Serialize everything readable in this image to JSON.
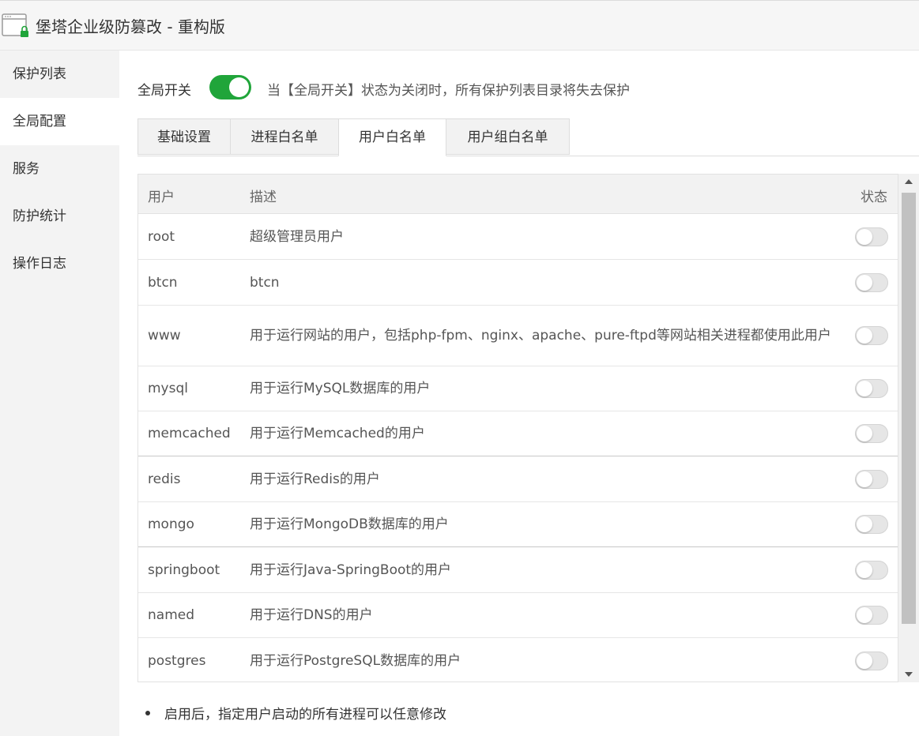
{
  "window": {
    "title": "堡塔企业级防篡改 - 重构版"
  },
  "sidebar": {
    "items": [
      {
        "label": "保护列表",
        "active": false
      },
      {
        "label": "全局配置",
        "active": true
      },
      {
        "label": "服务",
        "active": false
      },
      {
        "label": "防护统计",
        "active": false
      },
      {
        "label": "操作日志",
        "active": false
      }
    ]
  },
  "global_switch": {
    "label": "全局开关",
    "enabled": true,
    "hint": "当【全局开关】状态为关闭时，所有保护列表目录将失去保护"
  },
  "tabs": [
    {
      "label": "基础设置",
      "active": false
    },
    {
      "label": "进程白名单",
      "active": false
    },
    {
      "label": "用户白名单",
      "active": true
    },
    {
      "label": "用户组白名单",
      "active": false
    }
  ],
  "table": {
    "headers": {
      "user": "用户",
      "desc": "描述",
      "status": "状态"
    },
    "rows": [
      {
        "user": "root",
        "desc": "超级管理员用户",
        "enabled": false
      },
      {
        "user": "btcn",
        "desc": "btcn",
        "enabled": false
      },
      {
        "user": "www",
        "desc": "用于运行网站的用户，包括php-fpm、nginx、apache、pure-ftpd等网站相关进程都使用此用户",
        "enabled": false
      },
      {
        "user": "mysql",
        "desc": "用于运行MySQL数据库的用户",
        "enabled": false
      },
      {
        "user": "memcached",
        "desc": "用于运行Memcached的用户",
        "enabled": false
      },
      {
        "user": "redis",
        "desc": "用于运行Redis的用户",
        "enabled": false
      },
      {
        "user": "mongo",
        "desc": "用于运行MongoDB数据库的用户",
        "enabled": false
      },
      {
        "user": "springboot",
        "desc": "用于运行Java-SpringBoot的用户",
        "enabled": false
      },
      {
        "user": "named",
        "desc": "用于运行DNS的用户",
        "enabled": false
      },
      {
        "user": "postgres",
        "desc": "用于运行PostgreSQL数据库的用户",
        "enabled": false
      }
    ]
  },
  "notes": [
    "启用后，指定用户启动的所有进程可以任意修改"
  ],
  "colors": {
    "accent_green": "#20a53a",
    "sidebar_bg": "#f3f3f3",
    "toggle_off": "#e6e6e6"
  },
  "icons": {
    "app": "window-lock-icon"
  }
}
